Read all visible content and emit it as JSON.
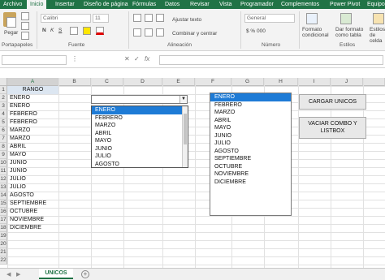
{
  "ribbon": {
    "tabs": [
      "Archivo",
      "Inicio",
      "Insertar",
      "Diseño de página",
      "Fórmulas",
      "Datos",
      "Revisar",
      "Vista",
      "Programador",
      "Complementos",
      "Power Pivot",
      "Equipo"
    ],
    "active_tab": "Inicio",
    "paste_label": "Pegar",
    "font_name": "Calibri",
    "font_size": "11",
    "wrap_text": "Ajustar texto",
    "merge_center": "Combinar y centrar",
    "number_format": "General",
    "number_symbols": "$ % 000",
    "conditional_format": "Formato condicional",
    "format_as_table": "Dar formato como tabla",
    "cell_styles": "Estilos de celda",
    "groups": {
      "clipboard": "Portapapeles",
      "font": "Fuente",
      "alignment": "Alineación",
      "number": "Número",
      "styles": "Estilos"
    }
  },
  "formula_bar": {
    "fx": "fx"
  },
  "columns": [
    "A",
    "B",
    "C",
    "D",
    "E",
    "F",
    "G",
    "H",
    "I",
    "J"
  ],
  "rows": [
    "1",
    "2",
    "3",
    "4",
    "5",
    "6",
    "7",
    "8",
    "9",
    "10",
    "11",
    "12",
    "13",
    "14",
    "15",
    "16",
    "17",
    "18",
    "19",
    "20",
    "21",
    "22"
  ],
  "column_a": {
    "header": "RANGO",
    "values": [
      "ENERO",
      "ENERO",
      "FEBRERO",
      "FEBRERO",
      "MARZO",
      "MARZO",
      "ABRIL",
      "MAYO",
      "JUNIO",
      "JUNIO",
      "JULIO",
      "JULIO",
      "AGOSTO",
      "SEPTIEMBRE",
      "OCTUBRE",
      "NOVIEMBRE",
      "DICIEMBRE"
    ]
  },
  "combo": {
    "value": "",
    "dropdown_items": [
      "ENERO",
      "FEBRERO",
      "MARZO",
      "ABRIL",
      "MAYO",
      "JUNIO",
      "JULIO",
      "AGOSTO"
    ],
    "highlighted": "ENERO"
  },
  "listbox": {
    "items": [
      "ENERO",
      "FEBRERO",
      "MARZO",
      "ABRIL",
      "MAYO",
      "JUNIO",
      "JULIO",
      "AGOSTO",
      "SEPTIEMBRE",
      "OCTUBRE",
      "NOVIEMBRE",
      "DICIEMBRE"
    ],
    "highlighted": "ENERO"
  },
  "buttons": {
    "load_unique": "CARGAR UNICOS",
    "clear_line1": "VACIAR COMBO Y",
    "clear_line2": "LISTBOX"
  },
  "sheet": {
    "tab": "UNICOS",
    "add": "+"
  },
  "colors": {
    "excel_green": "#217346",
    "selection_blue": "#1e7bd6",
    "header_fill": "#dce6f1"
  }
}
